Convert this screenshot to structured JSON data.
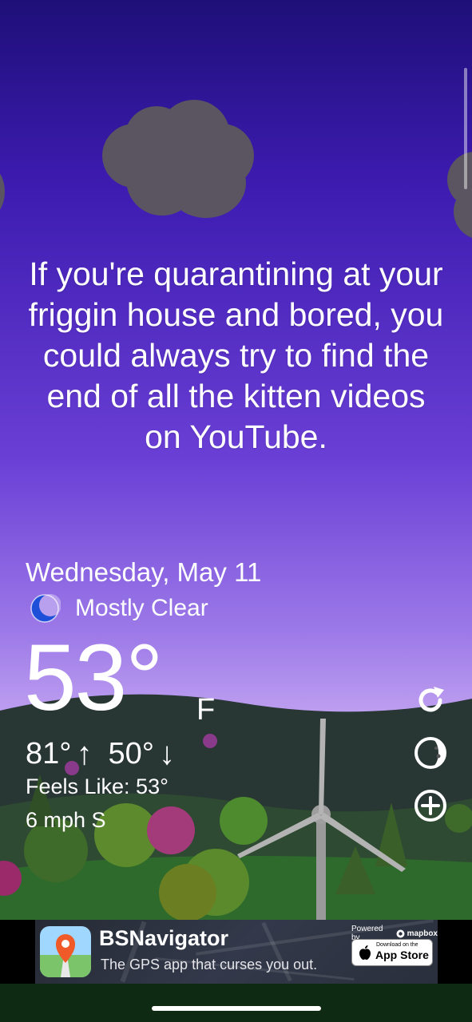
{
  "quote": {
    "text": "If you're quarantining at your friggin house and bored, you could always try to find the end of all the kitten videos on YouTube."
  },
  "weather": {
    "date": "Wednesday, May 11",
    "condition": "Mostly Clear",
    "condition_icon": "moon-icon",
    "temperature": "53°",
    "unit": "F",
    "high": "81°",
    "low": "50°",
    "high_arrow": "↑",
    "low_arrow": "↓",
    "feels_like": "Feels Like: 53°",
    "wind": "6 mph S"
  },
  "actions": {
    "refresh_icon": "refresh-icon",
    "theme_icon": "theme-toggle-icon",
    "add_icon": "add-location-icon"
  },
  "ad": {
    "title": "BSNavigator",
    "subtitle": "The GPS app that curses you out.",
    "powered_by": "Powered by",
    "provider": "mapbox",
    "store_small": "Download on the",
    "store_big": "App Store"
  },
  "colors": {
    "sky_top": "#1e0f78",
    "sky_bottom": "#c6a9f2",
    "moon": "#1d4fd8",
    "cloud": "#5a5560",
    "ground": "#2b3b2c"
  }
}
